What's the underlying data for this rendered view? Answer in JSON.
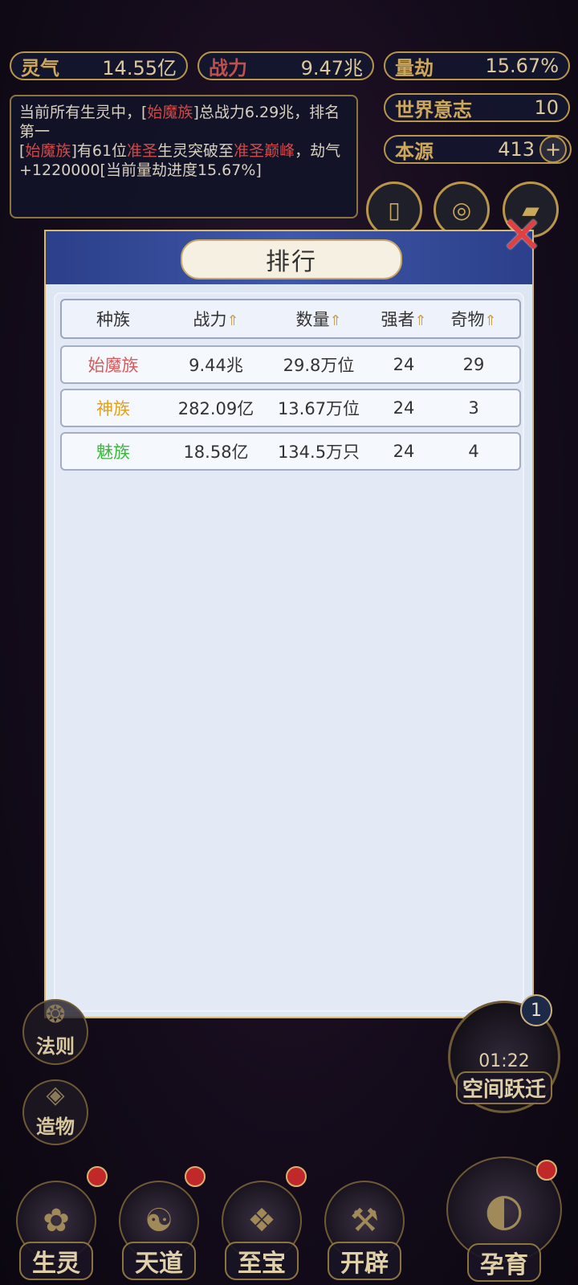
{
  "stats": {
    "lingqi_label": "灵气",
    "lingqi_value": "14.55亿",
    "zhanli_label": "战力",
    "zhanli_value": "9.47兆",
    "liangjie_label": "量劫",
    "liangjie_value": "15.67%",
    "shijie_label": "世界意志",
    "shijie_value": "10",
    "benyuan_label": "本源",
    "benyuan_value": "413",
    "plus": "+"
  },
  "log": {
    "line1_a": "当前所有生灵中，[",
    "line1_b": "始魔族",
    "line1_c": "]总战力6.29兆，排名第一",
    "line2_a": "[",
    "line2_b": "始魔族",
    "line2_c": "]有61位",
    "line2_d": "准圣",
    "line2_e": "生灵突破至",
    "line2_f": "准圣巅峰",
    "line2_g": "，劫气+1220000[当前量劫进度15.67%]"
  },
  "panel": {
    "title": "排行",
    "close_glyph": "✕",
    "headers": [
      "种族",
      "战力",
      "数量",
      "强者",
      "奇物"
    ],
    "sort_glyph": "⇑",
    "rows": [
      {
        "name": "始魔族",
        "color": "#d85a5a",
        "power": "9.44兆",
        "count": "29.8万位",
        "strong": "24",
        "items": "29"
      },
      {
        "name": "神族",
        "color": "#e0a020",
        "power": "282.09亿",
        "count": "13.67万位",
        "strong": "24",
        "items": "3"
      },
      {
        "name": "魅族",
        "color": "#3cb83c",
        "power": "18.58亿",
        "count": "134.5万只",
        "strong": "24",
        "items": "4"
      }
    ]
  },
  "side_left": [
    "法则",
    "造物"
  ],
  "timer": {
    "time": "01:22",
    "label": "空间跃迁",
    "badge": "1"
  },
  "bottom": [
    "生灵",
    "天道",
    "至宝",
    "开辟",
    "孕育"
  ]
}
